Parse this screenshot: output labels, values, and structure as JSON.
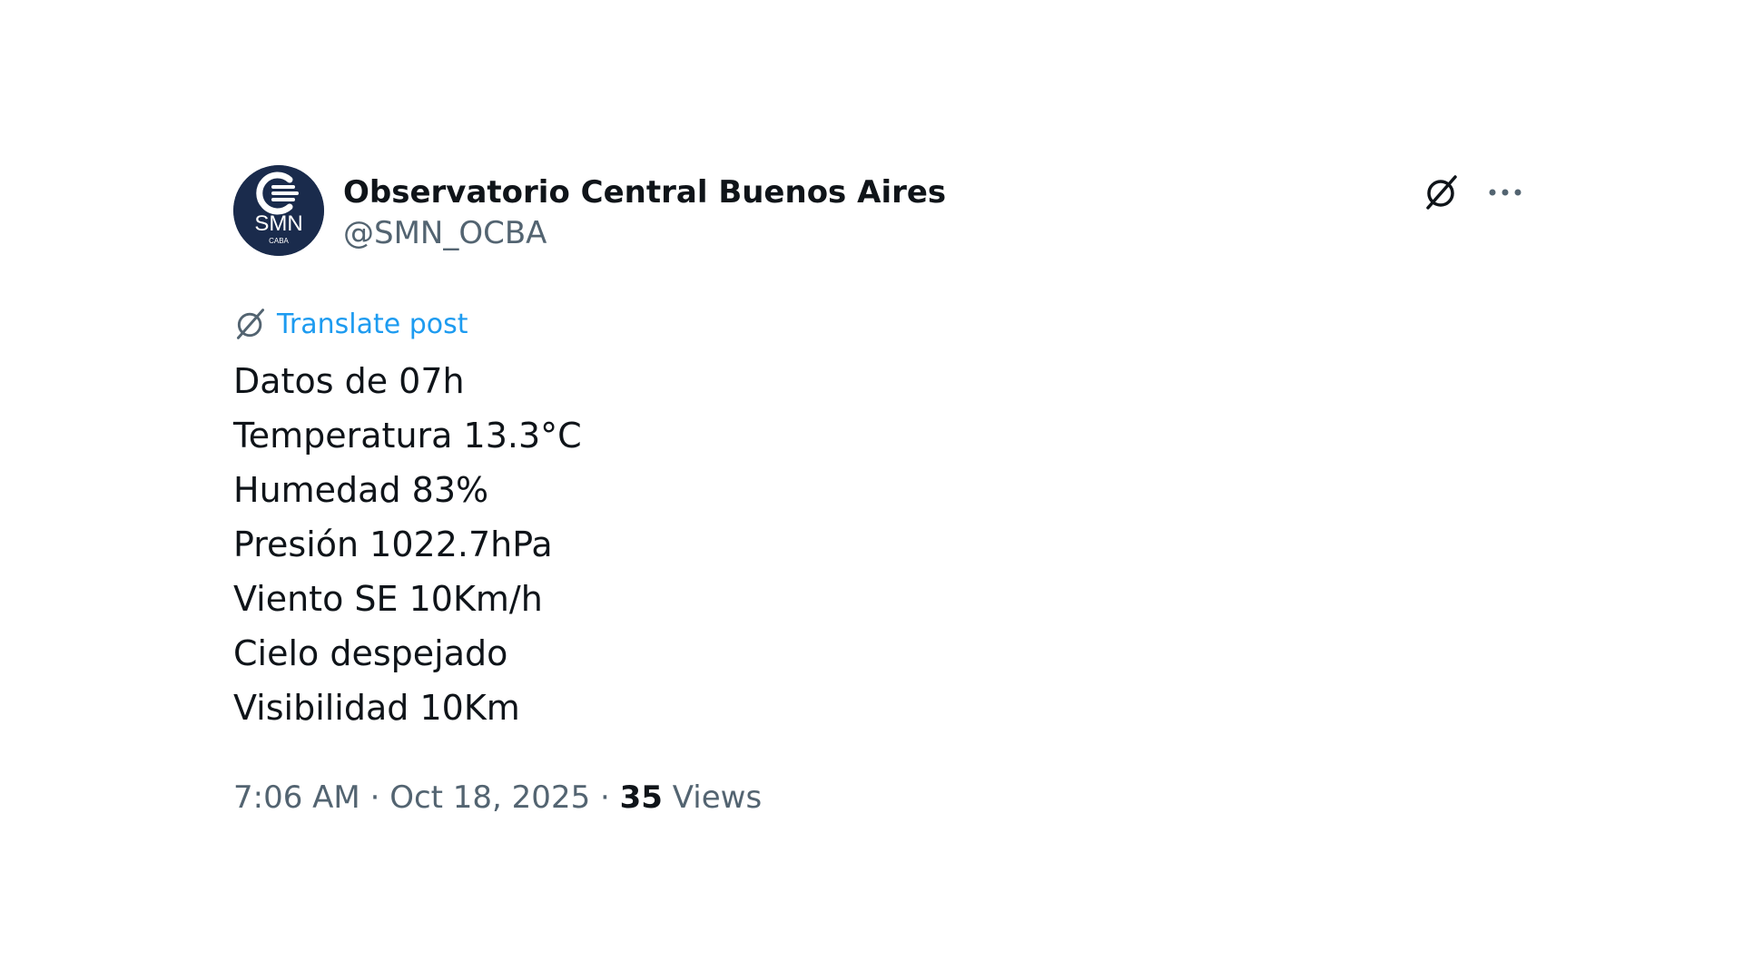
{
  "post": {
    "author": {
      "display_name": "Observatorio Central Buenos Aires",
      "handle": "@SMN_OCBA",
      "avatar": {
        "logo_text": "SMN",
        "logo_subtext": "CABA",
        "background_color": "#1a2b4c"
      }
    },
    "header_icons": {
      "grok": "grok-icon",
      "more": "more-icon"
    },
    "translate": {
      "icon": "grok-icon",
      "label": "Translate post"
    },
    "body_lines": [
      "Datos de 07h",
      "Temperatura 13.3°C",
      "Humedad 83%",
      "Presión 1022.7hPa",
      "Viento SE 10Km/h",
      "Cielo despejado",
      "Visibilidad 10Km"
    ],
    "meta": {
      "time": "7:06 AM",
      "separator": "·",
      "date": "Oct 18, 2025",
      "views_count": "35",
      "views_label": "Views"
    },
    "colors": {
      "text_primary": "#0f1419",
      "text_secondary": "#536471",
      "link": "#1d9bf0"
    }
  }
}
